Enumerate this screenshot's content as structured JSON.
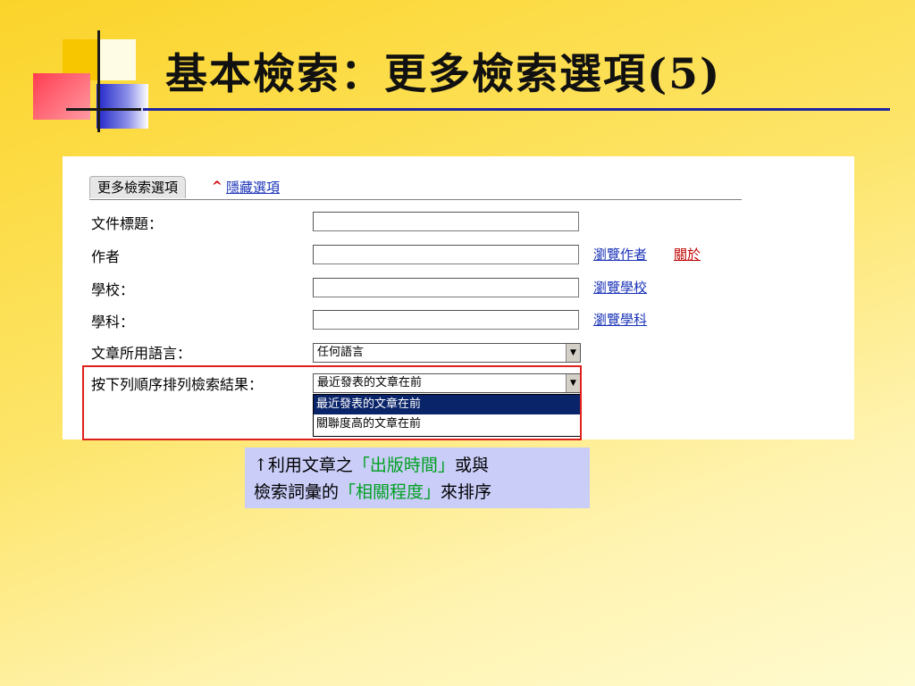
{
  "slide": {
    "title": "基本檢索：更多檢索選項(5)"
  },
  "panel": {
    "tab_label": "更多檢索選項",
    "caret": "^",
    "hide_link": "隱藏選項",
    "fields": {
      "doc_title_label": "文件標題：",
      "author_label": "作者",
      "school_label": "學校：",
      "subject_label": "學科：",
      "language_label": "文章所用語言：",
      "sort_label": "按下列順序排列檢索結果："
    },
    "links": {
      "browse_author": "瀏覽作者",
      "about": "關於",
      "browse_school": "瀏覽學校",
      "browse_subject": "瀏覽學科"
    },
    "language_select": {
      "value": "任何語言"
    },
    "sort_select": {
      "value": "最近發表的文章在前",
      "options": [
        "最近發表的文章在前",
        "關聯度高的文章在前"
      ]
    }
  },
  "callout": {
    "line1_prefix": "↑利用文章之",
    "line1_highlight": "「出版時間」",
    "line1_suffix": "或與",
    "line2_prefix": "檢索詞彙的",
    "line2_highlight": "「相關程度」",
    "line2_suffix": "來排序"
  },
  "colors": {
    "link": "#1a33b8",
    "link_red": "#c00000",
    "highlight_border": "#e0201a",
    "callout_bg": "#c9cdf8",
    "callout_green": "#00a020",
    "selected_option_bg": "#0a246a"
  }
}
